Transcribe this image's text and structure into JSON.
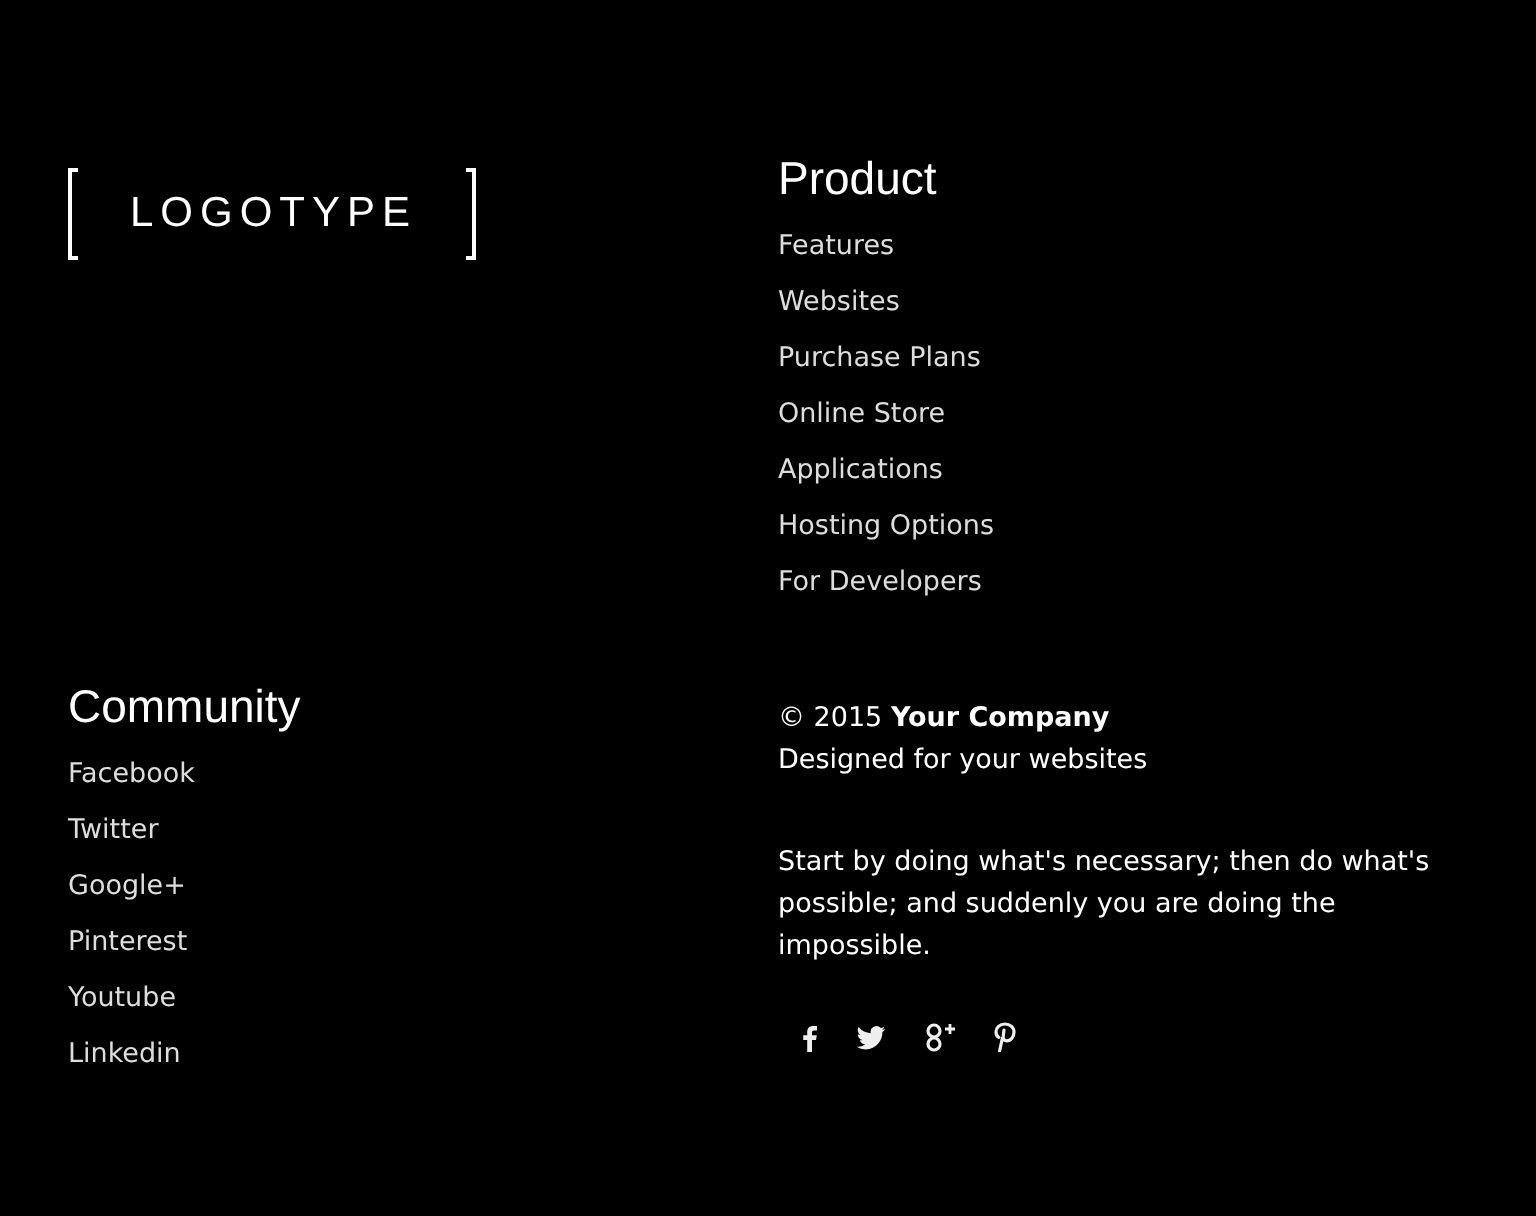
{
  "logo": {
    "text": "LOGOTYPE"
  },
  "product": {
    "title": "Product",
    "links": [
      "Features",
      "Websites",
      "Purchase Plans",
      "Online Store",
      "Applications",
      "Hosting Options",
      "For Developers"
    ]
  },
  "community": {
    "title": "Community",
    "links": [
      "Facebook",
      "Twitter",
      "Google+",
      "Pinterest",
      "Youtube",
      "Linkedin"
    ]
  },
  "copyright": "© 2015 **Your Company**",
  "tagline": "Designed for your websites",
  "quote": "Start by doing what's necessary; then do what's possible; and suddenly you are doing the impossible.",
  "social": [
    {
      "kind": "facebook"
    },
    {
      "kind": "twitter"
    },
    {
      "kind": "google-plus"
    },
    {
      "kind": "pinterest"
    }
  ]
}
